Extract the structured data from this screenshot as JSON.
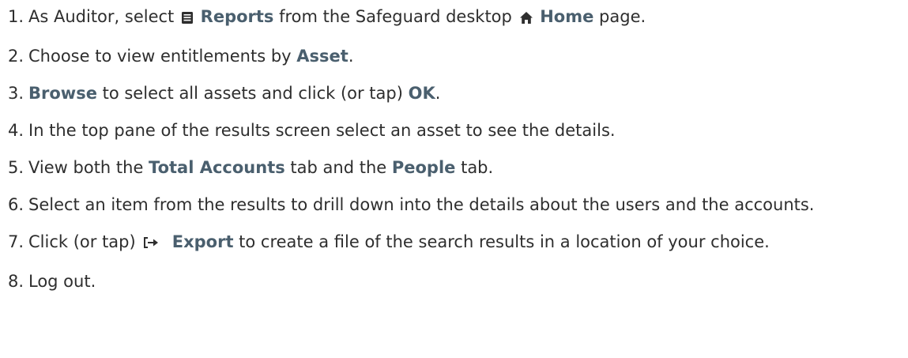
{
  "steps": [
    {
      "num": "1.",
      "t1": "As Auditor, select ",
      "b1": "Reports",
      "t2": " from the Safeguard desktop ",
      "b2": "Home",
      "t3": " page.",
      "icon1": "reports-list-icon",
      "icon2": "home-icon"
    },
    {
      "num": "2.",
      "t1": "Choose to view entitlements by ",
      "b1": "Asset",
      "t2": "."
    },
    {
      "num": "3.",
      "b1": "Browse",
      "t1": " to select all assets and click (or tap) ",
      "b2": "OK",
      "t2": "."
    },
    {
      "num": "4.",
      "t1": "In the top pane of the results screen select an asset to see the details."
    },
    {
      "num": "5.",
      "t1": "View both the ",
      "b1": "Total Accounts",
      "t2": " tab and the ",
      "b2": "People",
      "t3": " tab."
    },
    {
      "num": "6.",
      "t1": "Select an item from the results to drill down into the details about the users and the accounts."
    },
    {
      "num": "7.",
      "t1": "Click (or tap) ",
      "icon1": "export-icon",
      "b1": "Export",
      "t2": " to create a file of the search results in a location of your choice."
    },
    {
      "num": "8.",
      "t1": "Log out."
    }
  ]
}
